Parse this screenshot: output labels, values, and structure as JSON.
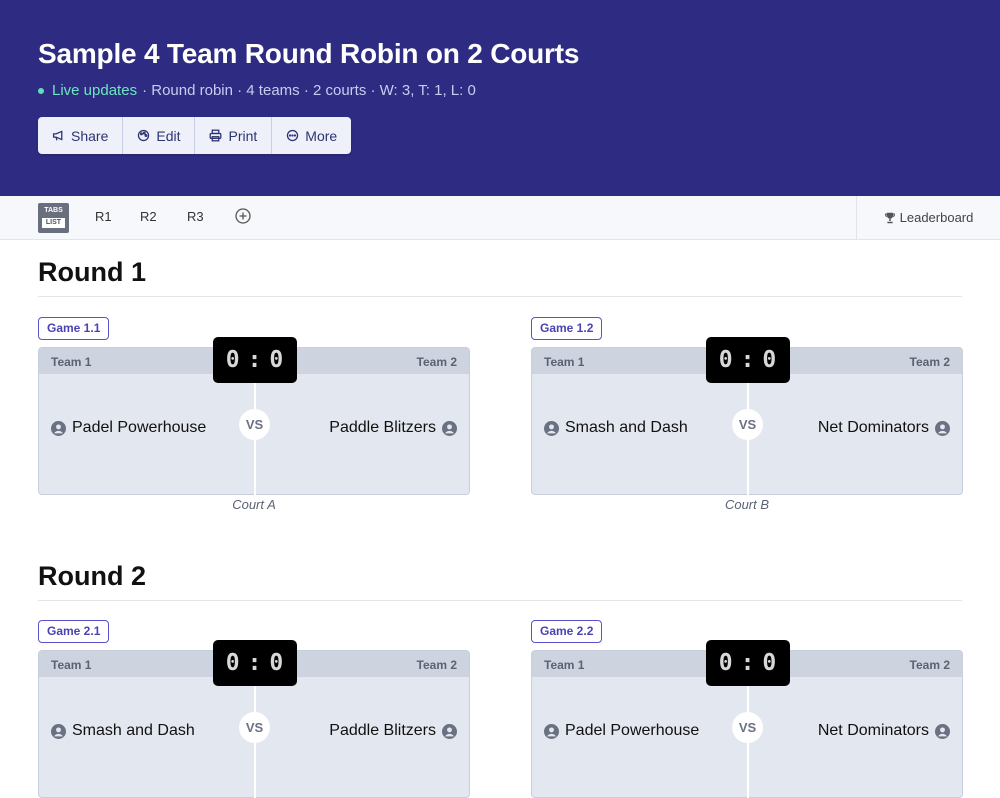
{
  "header": {
    "title": "Sample 4 Team Round Robin on 2 Courts",
    "live_label": "Live updates",
    "meta": "· Round robin · 4 teams · 2 courts · W: 3, T: 1, L: 0",
    "actions": {
      "share": "Share",
      "edit": "Edit",
      "print": "Print",
      "more": "More"
    }
  },
  "tabbar": {
    "view_toggle": {
      "top": "TABS",
      "bottom": "LIST"
    },
    "tabs": [
      "R1",
      "R2",
      "R3"
    ],
    "leaderboard": "Leaderboard"
  },
  "rounds": [
    {
      "title": "Round 1",
      "games": [
        {
          "label": "Game 1.1",
          "team1_header": "Team 1",
          "team2_header": "Team 2",
          "score1": "0",
          "score2": "0",
          "vs": "VS",
          "team1": "Padel Powerhouse",
          "team2": "Paddle Blitzers",
          "court": "Court A"
        },
        {
          "label": "Game 1.2",
          "team1_header": "Team 1",
          "team2_header": "Team 2",
          "score1": "0",
          "score2": "0",
          "vs": "VS",
          "team1": "Smash and Dash",
          "team2": "Net Dominators",
          "court": "Court B"
        }
      ]
    },
    {
      "title": "Round 2",
      "games": [
        {
          "label": "Game 2.1",
          "team1_header": "Team 1",
          "team2_header": "Team 2",
          "score1": "0",
          "score2": "0",
          "vs": "VS",
          "team1": "Smash and Dash",
          "team2": "Paddle Blitzers"
        },
        {
          "label": "Game 2.2",
          "team1_header": "Team 1",
          "team2_header": "Team 2",
          "score1": "0",
          "score2": "0",
          "vs": "VS",
          "team1": "Padel Powerhouse",
          "team2": "Net Dominators"
        }
      ]
    }
  ],
  "colors": {
    "header_bg": "#2e2c82",
    "live": "#6ee5bf",
    "accent": "#4b43b4"
  }
}
